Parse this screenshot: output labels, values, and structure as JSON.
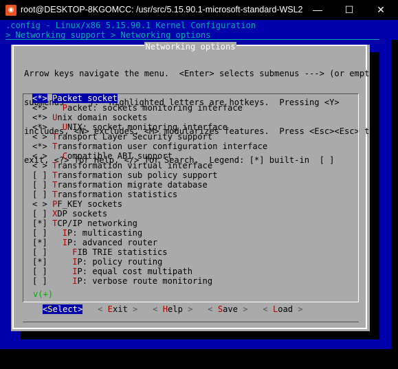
{
  "window": {
    "title": "root@DESKTOP-8KGOMCC: /usr/src/5.15.90.1-microsoft-standard-WSL2",
    "icon": "ubuntu-icon",
    "min_glyph": "—",
    "max_glyph": "☐",
    "close_glyph": "✕"
  },
  "terminal": {
    "header_line1": ".config - Linux/x86 5.15.90.1 Kernel Configuration",
    "header_line2": "> Networking support > Networking options"
  },
  "dialog": {
    "title": "Networking options",
    "help": [
      "Arrow keys navigate the menu.  <Enter> selects submenus ---> (or empty",
      "submenus ----).  Highlighted letters are hotkeys.  Pressing <Y>",
      "includes, <N> excludes, <M> modularizes features.  Press <Esc><Esc> to",
      "exit, <?> for Help, </> for Search.  Legend: [*] built-in  [ ]"
    ],
    "items": [
      {
        "state": "<*>",
        "indent": "",
        "hotkey": "P",
        "rest": "acket socket",
        "selected": true
      },
      {
        "state": "<*>",
        "indent": "  ",
        "hotkey": "P",
        "rest": "acket: sockets monitoring interface",
        "selected": false
      },
      {
        "state": "<*>",
        "indent": "",
        "hotkey": "U",
        "rest": "nix domain sockets",
        "selected": false
      },
      {
        "state": "<*>",
        "indent": "  ",
        "hotkey": "U",
        "rest": "NIX: socket monitoring interface",
        "selected": false
      },
      {
        "state": "< >",
        "indent": "",
        "hotkey": "T",
        "rest": "ransport Layer Security support",
        "selected": false
      },
      {
        "state": "<*>",
        "indent": "",
        "hotkey": "T",
        "rest": "ransformation user configuration interface",
        "selected": false
      },
      {
        "state": "< >",
        "indent": "  ",
        "hotkey": "C",
        "rest": "ompatible ABI support",
        "selected": false
      },
      {
        "state": "< >",
        "indent": "",
        "hotkey": "T",
        "rest": "ransformation virtual interface",
        "selected": false
      },
      {
        "state": "[ ]",
        "indent": "",
        "hotkey": "T",
        "rest": "ransformation sub policy support",
        "selected": false
      },
      {
        "state": "[ ]",
        "indent": "",
        "hotkey": "T",
        "rest": "ransformation migrate database",
        "selected": false
      },
      {
        "state": "[ ]",
        "indent": "",
        "hotkey": "T",
        "rest": "ransformation statistics",
        "selected": false
      },
      {
        "state": "< >",
        "indent": "",
        "hotkey": "P",
        "rest": "F_KEY sockets",
        "selected": false
      },
      {
        "state": "[ ]",
        "indent": "",
        "hotkey": "X",
        "rest": "DP sockets",
        "selected": false
      },
      {
        "state": "[*]",
        "indent": "",
        "hotkey": "T",
        "rest": "CP/IP networking",
        "selected": false
      },
      {
        "state": "[ ]",
        "indent": "  ",
        "hotkey": "I",
        "rest": "P: multicasting",
        "selected": false
      },
      {
        "state": "[*]",
        "indent": "  ",
        "hotkey": "I",
        "rest": "P: advanced router",
        "selected": false
      },
      {
        "state": "[ ]",
        "indent": "    ",
        "hotkey": "F",
        "rest": "IB TRIE statistics",
        "selected": false
      },
      {
        "state": "[*]",
        "indent": "    ",
        "hotkey": "I",
        "rest": "P: policy routing",
        "selected": false
      },
      {
        "state": "[ ]",
        "indent": "    ",
        "hotkey": "I",
        "rest": "P: equal cost multipath",
        "selected": false
      },
      {
        "state": "[ ]",
        "indent": "    ",
        "hotkey": "I",
        "rest": "P: verbose route monitoring",
        "selected": false
      }
    ],
    "more_indicator": "v(+)",
    "buttons": [
      {
        "hotkey": "S",
        "rest": "elect",
        "selected": true
      },
      {
        "hotkey": "E",
        "rest": "xit",
        "selected": false
      },
      {
        "hotkey": "H",
        "rest": "elp",
        "selected": false
      },
      {
        "hotkey": "S",
        "rest": "ave",
        "selected": false
      },
      {
        "hotkey": "L",
        "rest": "oad",
        "selected": false
      }
    ]
  },
  "colors": {
    "background": "#0000ab",
    "dialog": "#aaaaaa",
    "highlight": "#0000aa",
    "hotkey": "#aa0000",
    "header": "#00aaaa"
  }
}
